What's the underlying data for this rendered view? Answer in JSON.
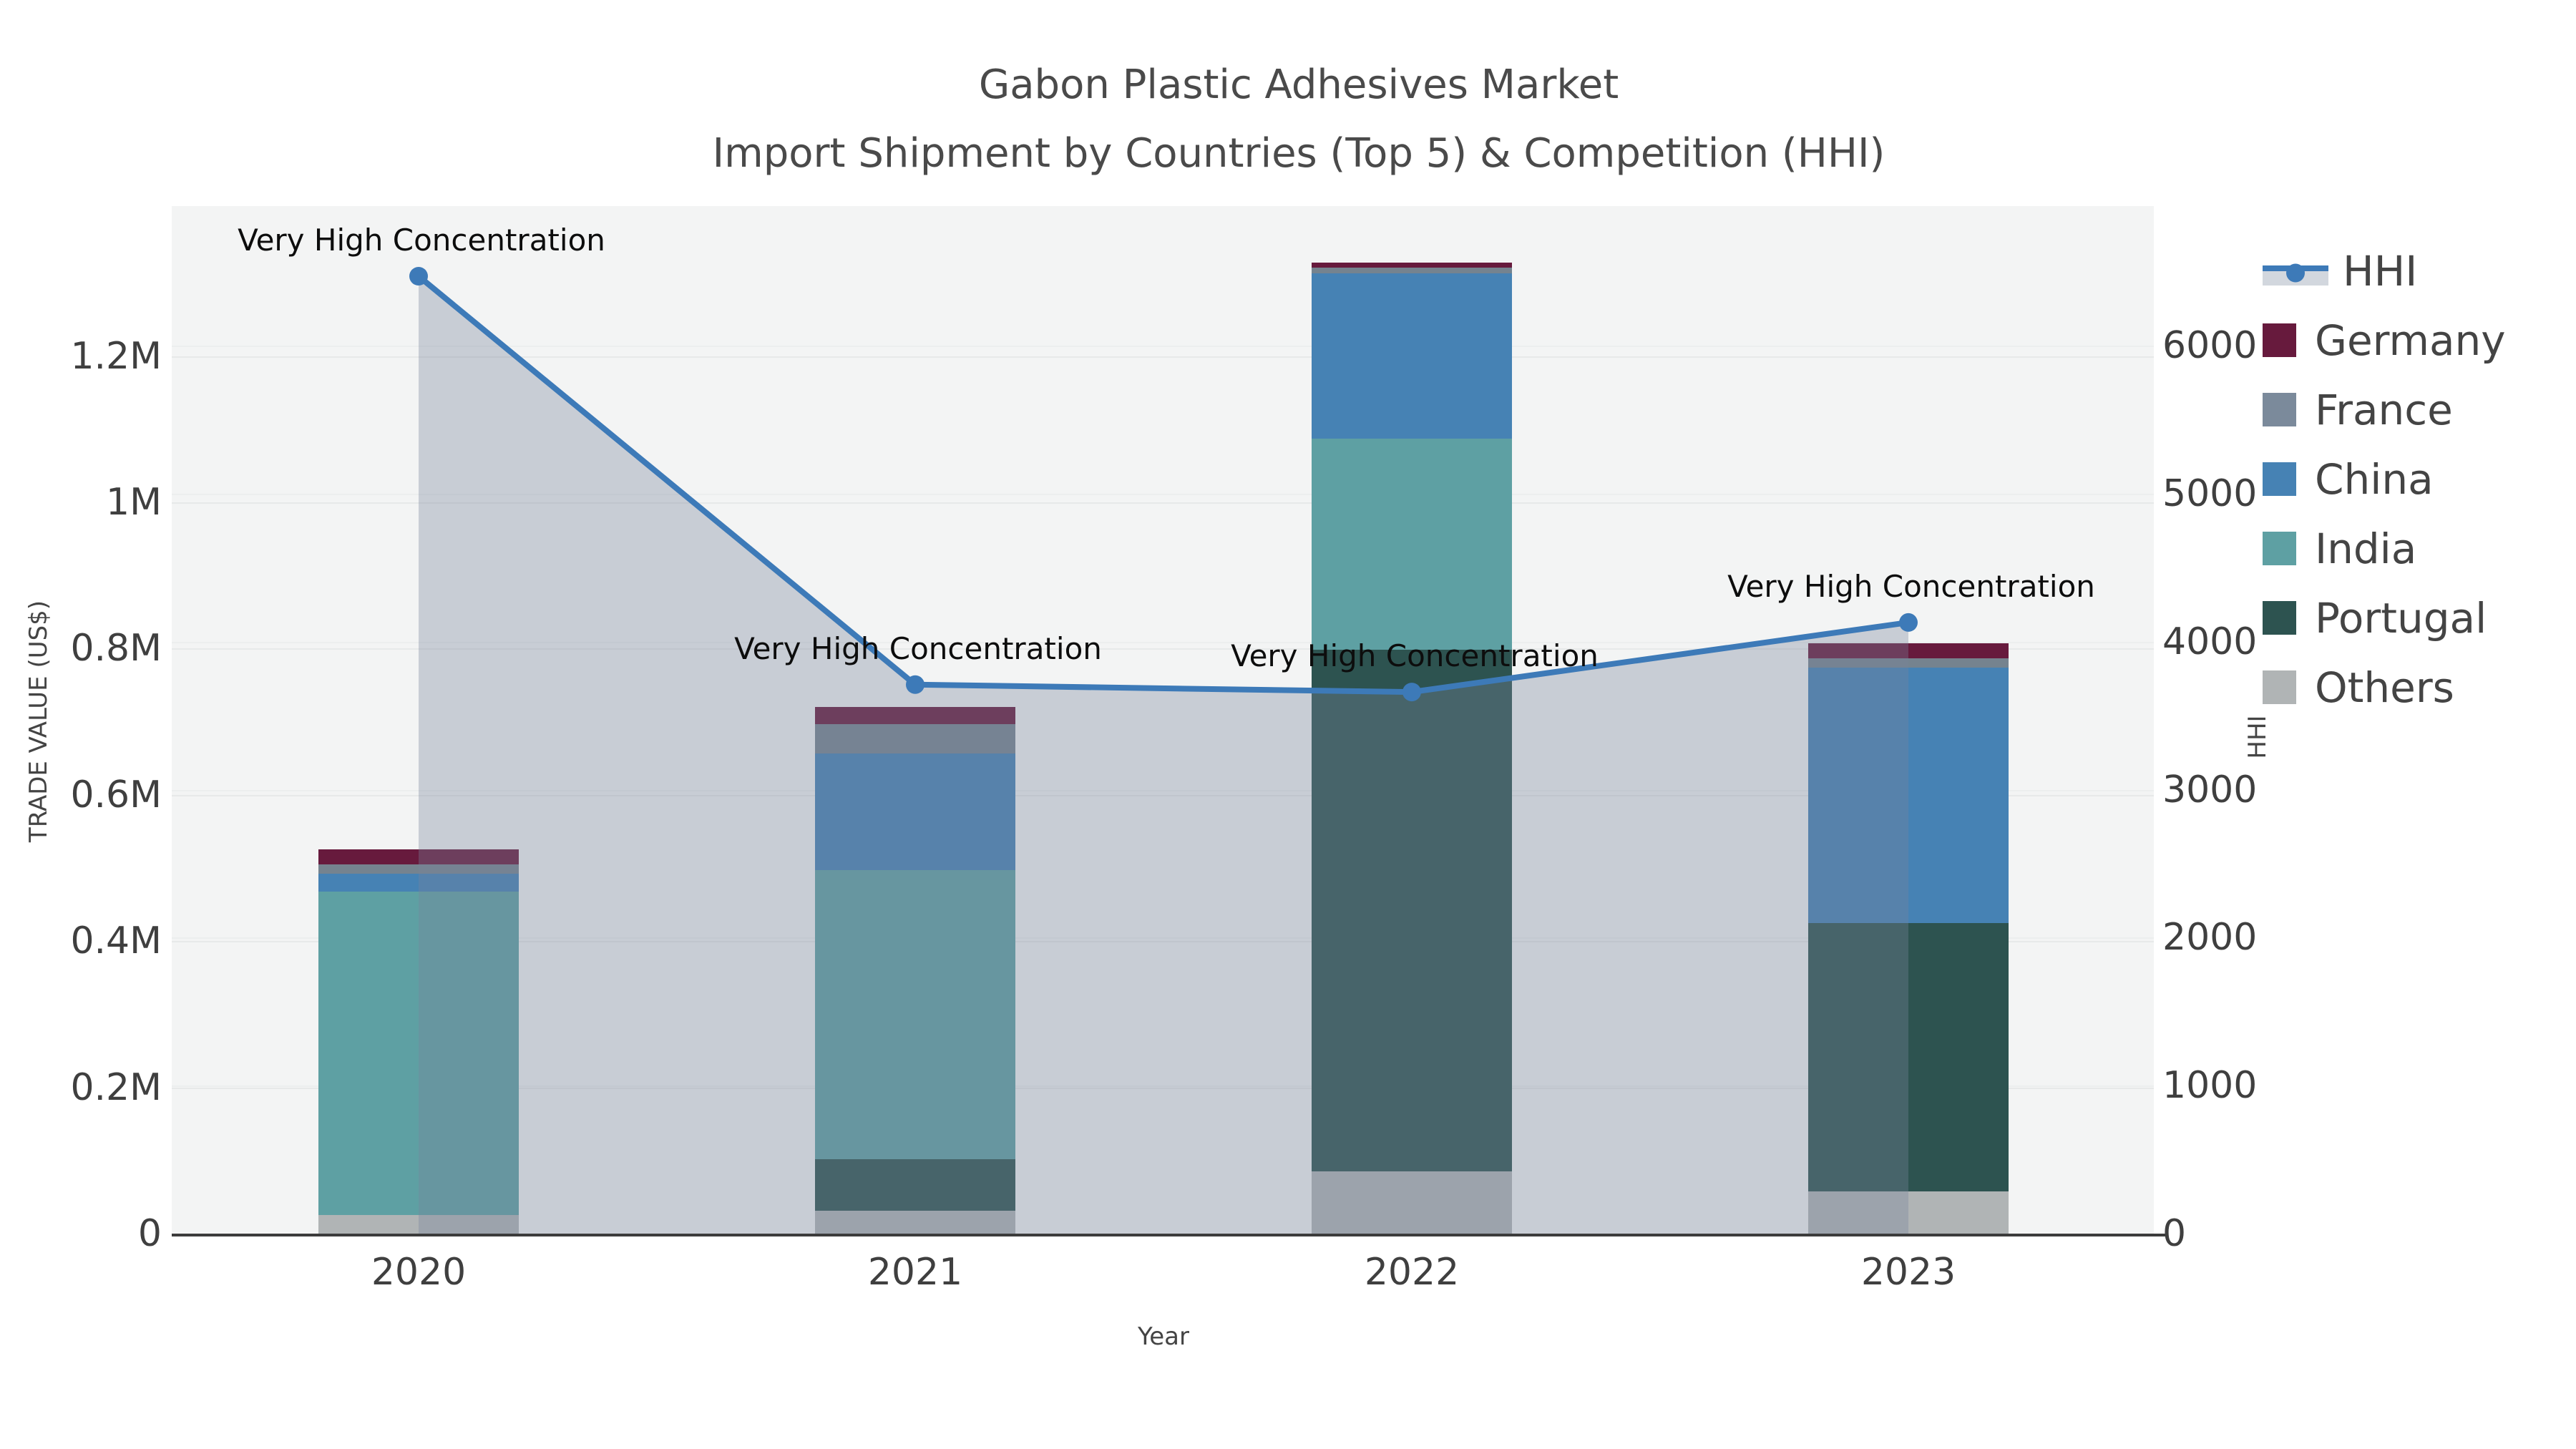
{
  "title": {
    "line1": "Gabon Plastic Adhesives Market",
    "line2": "Import Shipment by Countries (Top 5) & Competition (HHI)"
  },
  "axes": {
    "x_title": "Year",
    "y_left_title": "TRADE VALUE (US$)",
    "y_right_title": "HHI",
    "y_left_ticks": [
      {
        "label": "0",
        "value": 0
      },
      {
        "label": "0.2M",
        "value": 200000
      },
      {
        "label": "0.4M",
        "value": 400000
      },
      {
        "label": "0.6M",
        "value": 600000
      },
      {
        "label": "0.8M",
        "value": 800000
      },
      {
        "label": "1M",
        "value": 1000000
      },
      {
        "label": "1.2M",
        "value": 1200000
      }
    ],
    "y_right_ticks": [
      {
        "label": "0",
        "value": 0
      },
      {
        "label": "1000",
        "value": 1000
      },
      {
        "label": "2000",
        "value": 2000
      },
      {
        "label": "3000",
        "value": 3000
      },
      {
        "label": "4000",
        "value": 4000
      },
      {
        "label": "5000",
        "value": 5000
      },
      {
        "label": "6000",
        "value": 6000
      }
    ]
  },
  "chart_data": {
    "type": "bar",
    "subtype": "stacked-bars-with-line",
    "categories": [
      "2020",
      "2021",
      "2022",
      "2023"
    ],
    "series": [
      {
        "name": "Germany",
        "color": "#671a3d",
        "values": [
          20000,
          23000,
          7000,
          20000
        ]
      },
      {
        "name": "France",
        "color": "#75838f",
        "values": [
          13000,
          40000,
          8000,
          13000
        ]
      },
      {
        "name": "China",
        "color": "#4682b4",
        "values": [
          24000,
          160000,
          226000,
          349000
        ]
      },
      {
        "name": "India",
        "color": "#5ea0a3",
        "values": [
          443000,
          395000,
          289000,
          0
        ]
      },
      {
        "name": "Portugal",
        "color": "#2d5350",
        "values": [
          0,
          71000,
          713000,
          367000
        ]
      },
      {
        "name": "Others",
        "color": "#b0b4b5",
        "values": [
          25000,
          31000,
          85000,
          58000
        ]
      }
    ],
    "stack_order_bottom_to_top": [
      "Others",
      "Portugal",
      "India",
      "China",
      "France",
      "Germany"
    ],
    "line_series": {
      "name": "HHI",
      "color": "#3d7ab8",
      "fill_color": "rgba(120,133,155,0.35)",
      "values": [
        6470,
        3710,
        3660,
        4130
      ]
    },
    "annotations": [
      {
        "category": "2020",
        "text": "Very High Concentration"
      },
      {
        "category": "2021",
        "text": "Very High Concentration"
      },
      {
        "category": "2022",
        "text": "Very High Concentration"
      },
      {
        "category": "2023",
        "text": "Very High Concentration"
      }
    ],
    "title": "Gabon Plastic Adhesives Market — Import Shipment by Countries (Top 5) & Competition (HHI)",
    "xlabel": "Year",
    "ylabel_left": "TRADE VALUE (US$)",
    "ylabel_right": "HHI",
    "ylim_left": [
      0,
      1400000
    ],
    "ylim_right": [
      0,
      6950
    ],
    "grid": true,
    "legend_position": "right"
  },
  "legend": {
    "items": [
      {
        "label": "HHI",
        "type": "line",
        "color": "#3d7ab8"
      },
      {
        "label": "Germany",
        "type": "swatch",
        "color": "#671a3d"
      },
      {
        "label": "France",
        "type": "swatch",
        "color": "#7b8a9b"
      },
      {
        "label": "China",
        "type": "swatch",
        "color": "#4682b4"
      },
      {
        "label": "India",
        "type": "swatch",
        "color": "#5ea0a3"
      },
      {
        "label": "Portugal",
        "type": "swatch",
        "color": "#2d5350"
      },
      {
        "label": "Others",
        "type": "swatch",
        "color": "#b0b4b5"
      }
    ]
  },
  "colors": {
    "plot_background": "#f3f4f4",
    "gridline": "#e7e9e9",
    "axis_line": "#3c3c3c",
    "text": "#444444",
    "annotation_text": "#0d0d0d"
  }
}
